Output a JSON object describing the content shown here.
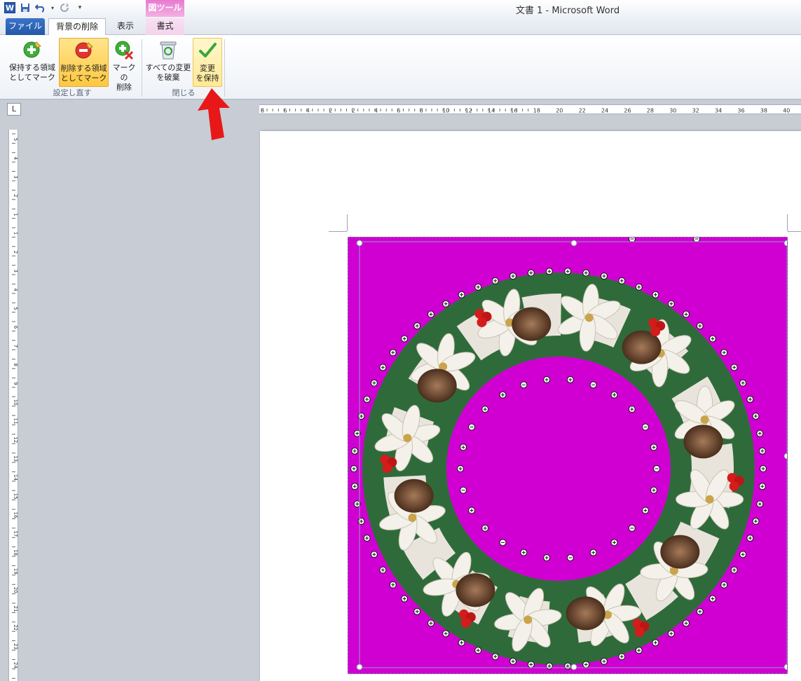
{
  "window": {
    "title": "文書 1 - Microsoft Word"
  },
  "qat": {
    "word_icon": "word-icon",
    "save_icon": "save-icon",
    "undo_icon": "undo-icon",
    "redo_icon": "redo-icon",
    "customize_icon": "dropdown-icon"
  },
  "context_group": {
    "label": "図ツール"
  },
  "tabs": {
    "file": "ファイル",
    "bg_remove": "背景の削除",
    "view": "表示",
    "format": "書式"
  },
  "ribbon": {
    "buttons": {
      "keep_mark": "保持する領域\nとしてマーク",
      "remove_mark": "削除する領域\nとしてマーク",
      "delete_mark": "マークの\n削除",
      "discard": "すべての変更\nを破棄",
      "keep_changes": "変更\nを保持"
    },
    "groups": {
      "redo": "設定し直す",
      "close": "閉じる"
    }
  },
  "ruler": {
    "corner": "L",
    "h_labels": [
      "8",
      "6",
      "4",
      "2",
      "2",
      "4",
      "6",
      "8",
      "10",
      "12",
      "14",
      "16",
      "18",
      "20",
      "22",
      "24",
      "26",
      "28",
      "30",
      "32",
      "34",
      "36",
      "38",
      "40"
    ],
    "v_labels": [
      "5",
      "4",
      "3",
      "2",
      "1",
      "1",
      "2",
      "3",
      "4",
      "5",
      "6",
      "7",
      "8",
      "9",
      "10",
      "11",
      "12",
      "13",
      "14",
      "15",
      "16",
      "17",
      "18",
      "19",
      "20",
      "21",
      "22",
      "23",
      "24"
    ]
  },
  "colors": {
    "removed_area": "#d000d2",
    "file_tab": "#2a5bb0",
    "arrow": "#e81818",
    "highlight": "#ffc840"
  }
}
